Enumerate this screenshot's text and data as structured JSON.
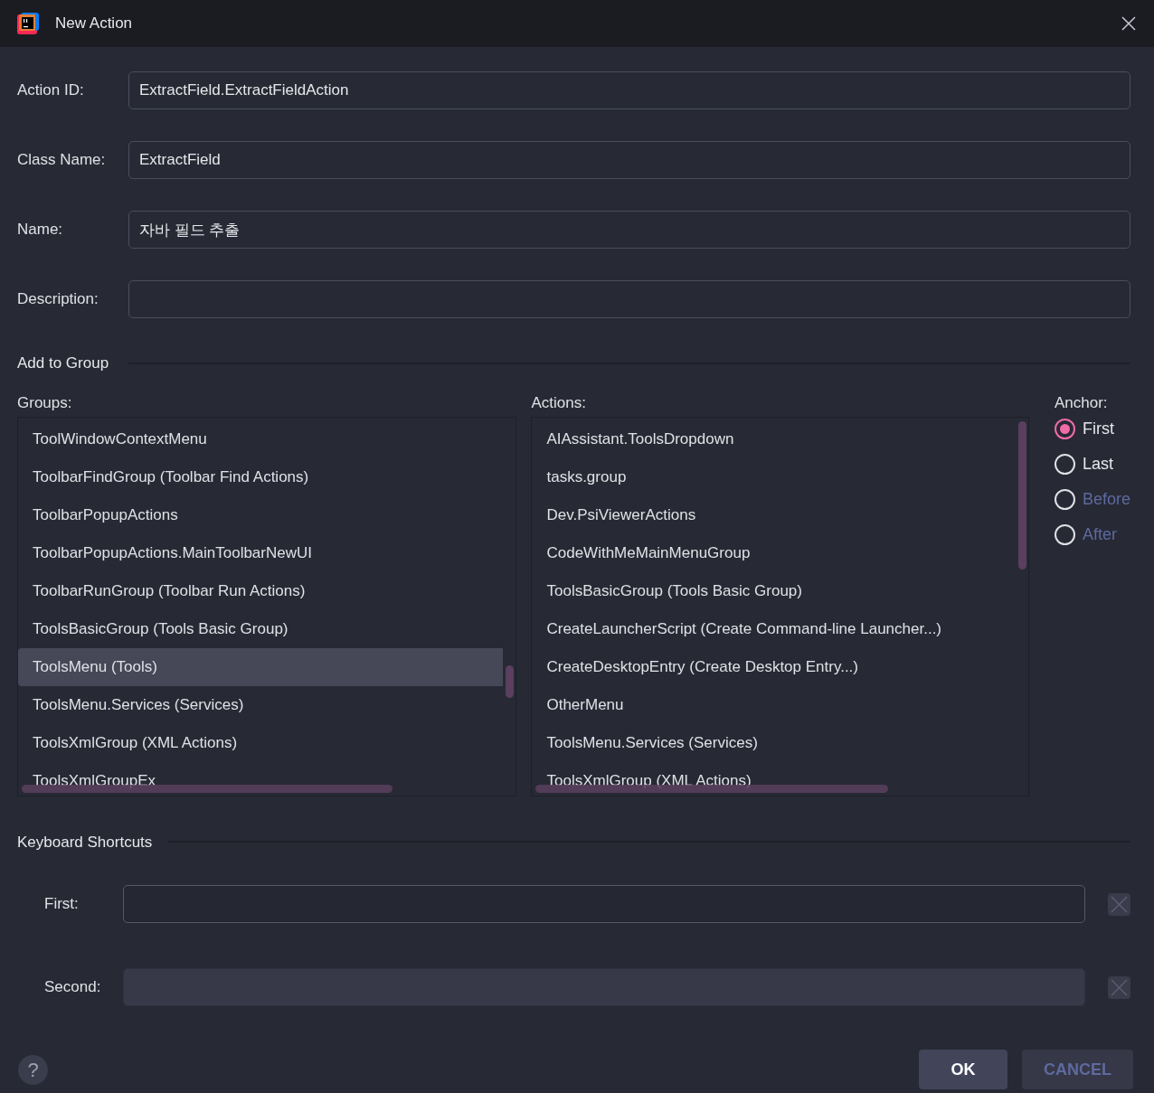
{
  "window": {
    "title": "New Action"
  },
  "fields": [
    {
      "label": "Action ID:",
      "value": "ExtractField.ExtractFieldAction"
    },
    {
      "label": "Class Name:",
      "value": "ExtractField"
    },
    {
      "label": "Name:",
      "value": "자바 필드 추출"
    },
    {
      "label": "Description:"
    }
  ],
  "add_to_group": {
    "title": "Add to Group",
    "groups": {
      "label": "Groups:",
      "items": [
        {
          "text": "ToolWindowContextMenu",
          "selected": false
        },
        {
          "text": "ToolbarFindGroup (Toolbar Find Actions)",
          "selected": false
        },
        {
          "text": "ToolbarPopupActions",
          "selected": false
        },
        {
          "text": "ToolbarPopupActions.MainToolbarNewUI",
          "selected": false
        },
        {
          "text": "ToolbarRunGroup (Toolbar Run Actions)",
          "selected": false
        },
        {
          "text": "ToolsBasicGroup (Tools Basic Group)",
          "selected": false
        },
        {
          "text": "ToolsMenu (Tools)",
          "selected": true
        },
        {
          "text": "ToolsMenu.Services (Services)",
          "selected": false
        },
        {
          "text": "ToolsXmlGroup (XML Actions)",
          "selected": false
        },
        {
          "text": "ToolsXmlGroupEx",
          "selected": false
        }
      ]
    },
    "actions": {
      "label": "Actions:",
      "items": [
        {
          "text": "AIAssistant.ToolsDropdown",
          "selected": false
        },
        {
          "text": "tasks.group",
          "selected": false
        },
        {
          "text": "Dev.PsiViewerActions",
          "selected": false
        },
        {
          "text": "CodeWithMeMainMenuGroup",
          "selected": false
        },
        {
          "text": "ToolsBasicGroup (Tools Basic Group)",
          "selected": false
        },
        {
          "text": "CreateLauncherScript (Create Command-line Launcher...)",
          "selected": false
        },
        {
          "text": "CreateDesktopEntry (Create Desktop Entry...)",
          "selected": false
        },
        {
          "text": "OtherMenu",
          "selected": false
        },
        {
          "text": "ToolsMenu.Services (Services)",
          "selected": false
        },
        {
          "text": "ToolsXmlGroup (XML Actions)",
          "selected": false
        }
      ]
    },
    "anchor": {
      "label": "Anchor:",
      "options": [
        {
          "label": "First",
          "selected": true,
          "disabled": false
        },
        {
          "label": "Last",
          "selected": false,
          "disabled": false
        },
        {
          "label": "Before",
          "selected": false,
          "disabled": true
        },
        {
          "label": "After",
          "selected": false,
          "disabled": true
        }
      ]
    }
  },
  "keyboard_shortcuts": {
    "title": "Keyboard Shortcuts",
    "fields": [
      {
        "label": "First:",
        "disabled": false
      },
      {
        "label": "Second:",
        "disabled": true
      }
    ]
  },
  "buttons": [
    {
      "label": "OK",
      "disabled": false
    },
    {
      "label": "CANCEL",
      "disabled": true
    }
  ],
  "help": {
    "label": "?"
  }
}
